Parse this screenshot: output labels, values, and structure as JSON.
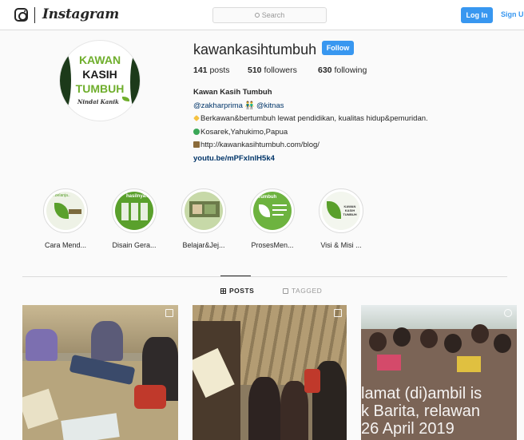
{
  "nav": {
    "wordmark": "Instagram",
    "search_placeholder": "Search",
    "login_label": "Log In",
    "signup_label": "Sign Up"
  },
  "profile": {
    "avatar_lines": [
      "KAWAN",
      "KASIH",
      "TUMBUH",
      "Nindai Kanik"
    ],
    "username": "kawankasihtumbuh",
    "follow_label": "Follow",
    "stats": {
      "posts_count": "141",
      "posts_label": "posts",
      "followers_count": "510",
      "followers_label": "followers",
      "following_count": "630",
      "following_label": "following"
    },
    "bio": {
      "name": "Kawan Kasih Tumbuh",
      "mentions": "@zakharprima 👬 @kitnas",
      "line1": "Berkawan&bertumbuh lewat pendidikan, kualitas hidup&pemuridan.",
      "line2": "Kosarek,Yahukimo,Papua",
      "line3": "http://kawankasihtumbuh.com/blog/",
      "link": "youtu.be/mPFxlnlH5k4"
    }
  },
  "highlights": [
    {
      "label": "Cara Mend...",
      "inner_text": "..belanja.."
    },
    {
      "label": "Disain Gera...",
      "inner_text": "hasilnya.."
    },
    {
      "label": "Belajar&Jej...",
      "inner_text": ""
    },
    {
      "label": "ProsesMen...",
      "inner_text": "Tumbuh"
    },
    {
      "label": "Visi & Misi ...",
      "inner_text": "KAWAN KASIH TUMBUH"
    }
  ],
  "tabs": [
    {
      "label": "POSTS",
      "active": true
    },
    {
      "label": "TAGGED",
      "active": false
    }
  ],
  "posts": [
    {
      "overlay_text": ""
    },
    {
      "overlay_text": ""
    },
    {
      "overlay_text": "lamat (di)ambil is\nk Barita, relawan\n26 April 2019"
    }
  ],
  "colors": {
    "accent": "#3897f0",
    "link": "#003569",
    "leaf_green": "#5aa02c"
  }
}
